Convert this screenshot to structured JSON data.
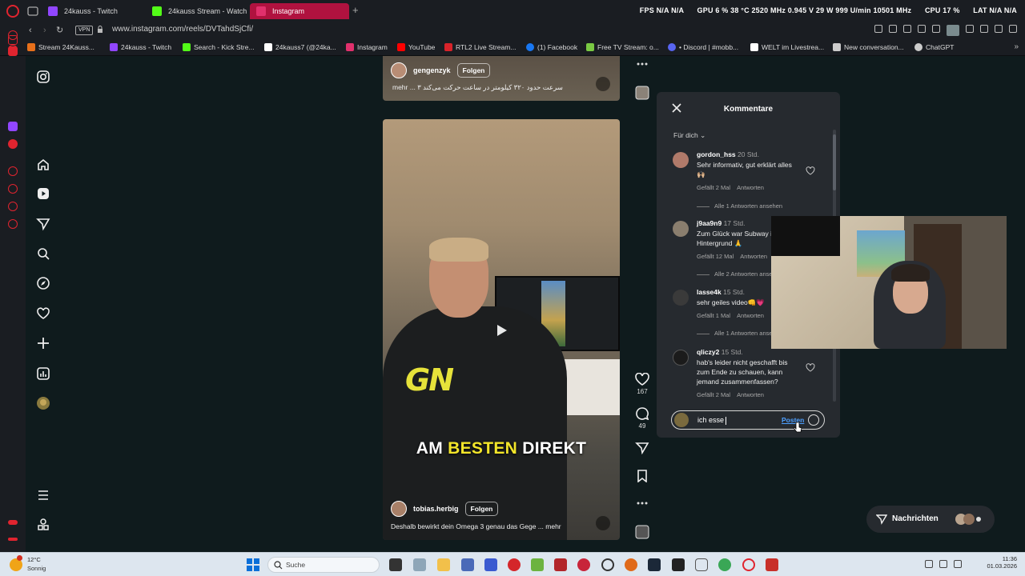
{
  "browser": {
    "tabs": [
      {
        "label": "24kauss - Twitch",
        "color": "#9146ff"
      },
      {
        "label": "24kauss Stream - Watch",
        "color": "#53fc18"
      },
      {
        "label": "Instagram",
        "color": "#e1306c",
        "active": true
      }
    ],
    "sysinfo": [
      "FPS N/A N/A",
      "GPU 6 % 38 °C 2520 MHz 0.945 V 29 W 999 U/min 10501 MHz",
      "CPU 17 %",
      "LAT N/A N/A"
    ],
    "vpn_label": "VPN",
    "url": "www.instagram.com/reels/DVTahdSjCfi/",
    "bookmarks": [
      {
        "label": "Stream 24Kauss...",
        "color": "#e8701a"
      },
      {
        "label": "24kauss - Twitch",
        "color": "#9146ff"
      },
      {
        "label": "Search - Kick Stre...",
        "color": "#53fc18"
      },
      {
        "label": "24kauss7 (@24ka...",
        "color": "#ffffff"
      },
      {
        "label": "Instagram",
        "color": "#e1306c"
      },
      {
        "label": "YouTube",
        "color": "#ff0000"
      },
      {
        "label": "RTL2 Live Stream...",
        "color": "#d8232a"
      },
      {
        "label": "(1) Facebook",
        "color": "#1877f2"
      },
      {
        "label": "Free TV Stream: o...",
        "color": "#7ac943"
      },
      {
        "label": "• Discord | #mobb...",
        "color": "#5865f2"
      },
      {
        "label": "WELT im Livestrea...",
        "color": "#ffffff"
      },
      {
        "label": "New conversation...",
        "color": "#cccccc"
      },
      {
        "label": "ChatGPT",
        "color": "#cccccc"
      }
    ]
  },
  "reels": {
    "top": {
      "username": "gengenzyk",
      "follow": "Folgen",
      "caption": "سرعت حدود ۳۲۰ کیلومتر در ساعت حرکت می‌کند ۳ ... mehr"
    },
    "main": {
      "username": "tobias.herbig",
      "follow": "Folgen",
      "caption": "Deshalb bewirkt dein Omega 3 genau das Gege ... mehr",
      "shirt_logo": "GN",
      "subtitle_pre": "AM ",
      "subtitle_highlight": "BESTEN",
      "subtitle_post": " DIREKT"
    },
    "likes": "167",
    "comments_count": "49"
  },
  "comments": {
    "title": "Kommentare",
    "sort": "Für dich",
    "items": [
      {
        "user": "gordon_hss",
        "time": "20 Std.",
        "text": "Sehr informativ, gut erklärt alles 🙌🏼",
        "likes": "Gefällt 2 Mal",
        "reply": "Antworten",
        "replies": "Alle 1 Antworten ansehen"
      },
      {
        "user": "j9aa9n9",
        "time": "17 Std.",
        "text": "Zum Glück war Subway im Hintergrund 🙏",
        "likes": "Gefällt 12 Mal",
        "reply": "Antworten",
        "replies": "Alle 2 Antworten ansehen"
      },
      {
        "user": "lasse4k",
        "time": "15 Std.",
        "text": "sehr geiles video👊💗",
        "likes": "Gefällt 1 Mal",
        "reply": "Antworten",
        "replies": "Alle 1 Antworten ansehen"
      },
      {
        "user": "qliczy2",
        "time": "15 Std.",
        "text": "hab's leider nicht geschafft bis zum Ende zu schauen, kann jemand zusammenfassen?",
        "likes": "Gefällt 2 Mal",
        "reply": "Antworten"
      }
    ],
    "input_value": "ich esse",
    "post_label": "Posten"
  },
  "messages": {
    "label": "Nachrichten"
  },
  "taskbar": {
    "weather_temp": "12°C",
    "weather_desc": "Sonnig",
    "search_label": "Suche",
    "time": "11:36",
    "date": "01.03.2026"
  }
}
